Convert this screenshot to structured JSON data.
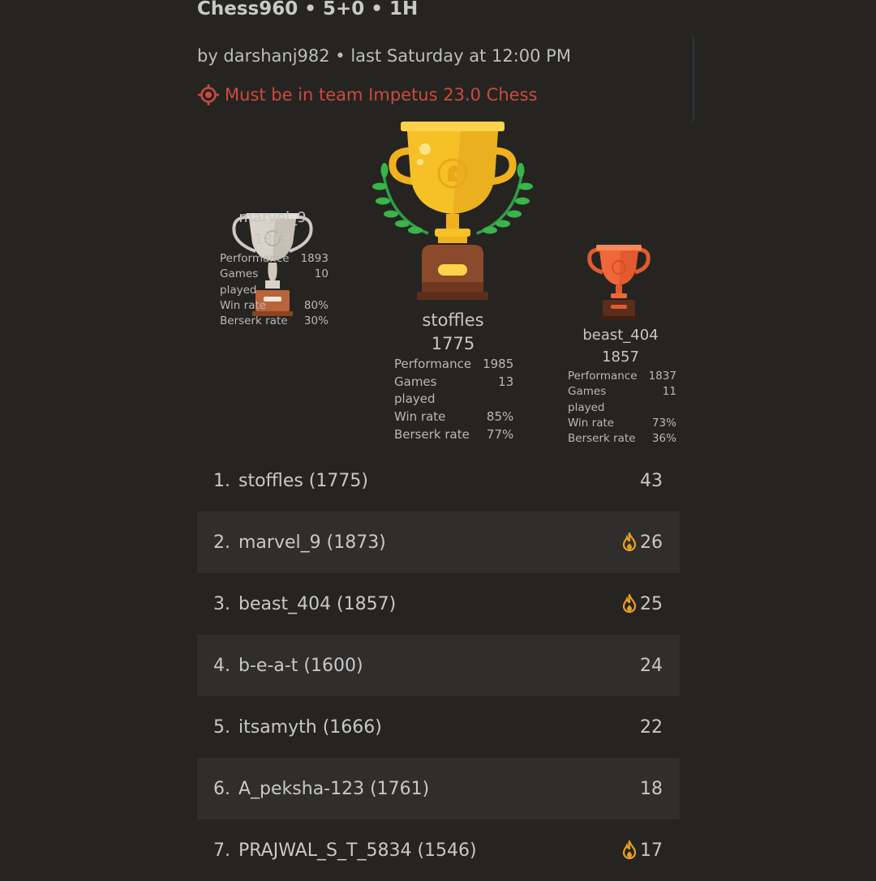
{
  "tournament": {
    "title": "Chess960 • 5+0 • 1H",
    "byline": "by darshanj982 • last Saturday at 12:00 PM",
    "condition": "Must be in team Impetus 23.0 Chess",
    "condition_icon": "target-icon",
    "condition_color": "#cc4a40"
  },
  "podium": {
    "first": {
      "name": "stoffles",
      "rating": "1775",
      "stats": [
        {
          "label": "Performance",
          "value": "1985"
        },
        {
          "label": "Games played",
          "value": "13"
        },
        {
          "label": "Win rate",
          "value": "85%"
        },
        {
          "label": "Berserk rate",
          "value": "77%"
        }
      ],
      "trophy_color": "#f5c127"
    },
    "second": {
      "name": "marvel_9",
      "rating": "1873",
      "stats": [
        {
          "label": "Performance",
          "value": "1893"
        },
        {
          "label": "Games played",
          "value": "10"
        },
        {
          "label": "Win rate",
          "value": "80%"
        },
        {
          "label": "Berserk rate",
          "value": "30%"
        }
      ],
      "trophy_color": "#d8d2c8"
    },
    "third": {
      "name": "beast_404",
      "rating": "1857",
      "stats": [
        {
          "label": "Performance",
          "value": "1837"
        },
        {
          "label": "Games played",
          "value": "11"
        },
        {
          "label": "Win rate",
          "value": "73%"
        },
        {
          "label": "Berserk rate",
          "value": "36%"
        }
      ],
      "trophy_color": "#f0683a"
    }
  },
  "standings": [
    {
      "rank": "1.",
      "player": "stoffles (1775)",
      "score": "43",
      "fire": false
    },
    {
      "rank": "2.",
      "player": "marvel_9 (1873)",
      "score": "26",
      "fire": true
    },
    {
      "rank": "3.",
      "player": "beast_404 (1857)",
      "score": "25",
      "fire": true
    },
    {
      "rank": "4.",
      "player": "b-e-a-t (1600)",
      "score": "24",
      "fire": false
    },
    {
      "rank": "5.",
      "player": "itsamyth (1666)",
      "score": "22",
      "fire": false
    },
    {
      "rank": "6.",
      "player": "A_peksha-123 (1761)",
      "score": "18",
      "fire": false
    },
    {
      "rank": "7.",
      "player": "PRAJWAL_S_T_5834 (1546)",
      "score": "17",
      "fire": true
    }
  ],
  "colors": {
    "background": "#262421",
    "row_alt": "#302e2c",
    "fire": "#e8a020"
  }
}
